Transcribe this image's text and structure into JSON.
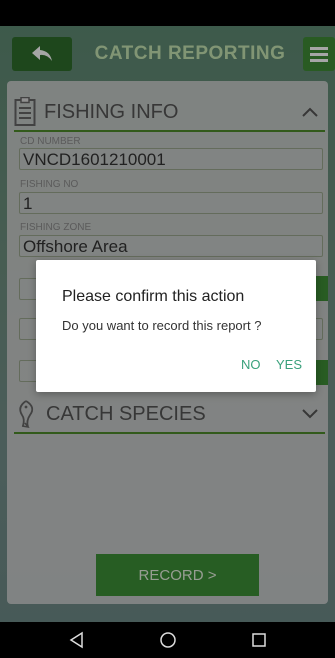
{
  "header": {
    "title": "CATCH REPORTING",
    "back_icon": "back-arrow-icon",
    "menu_icon": "hamburger-menu-icon"
  },
  "fishing_info": {
    "title": "FISHING INFO",
    "icon": "document-list-icon",
    "fields": [
      {
        "label": "CD NUMBER",
        "value": "VNCD1601210001"
      },
      {
        "label": "FISHING NO",
        "value": "1"
      },
      {
        "label": "FISHING ZONE",
        "value": "Offshore Area"
      }
    ]
  },
  "catch_species": {
    "title": "CATCH SPECIES",
    "icon": "fish-icon"
  },
  "record_button": {
    "label": "RECORD >"
  },
  "dialog": {
    "title": "Please confirm this action",
    "message": "Do you want to record this report ?",
    "no_label": "NO",
    "yes_label": "YES"
  },
  "colors": {
    "primary_green": "#3d8f37",
    "accent_teal": "#3aa17c",
    "title_green": "#c6e5b3"
  }
}
